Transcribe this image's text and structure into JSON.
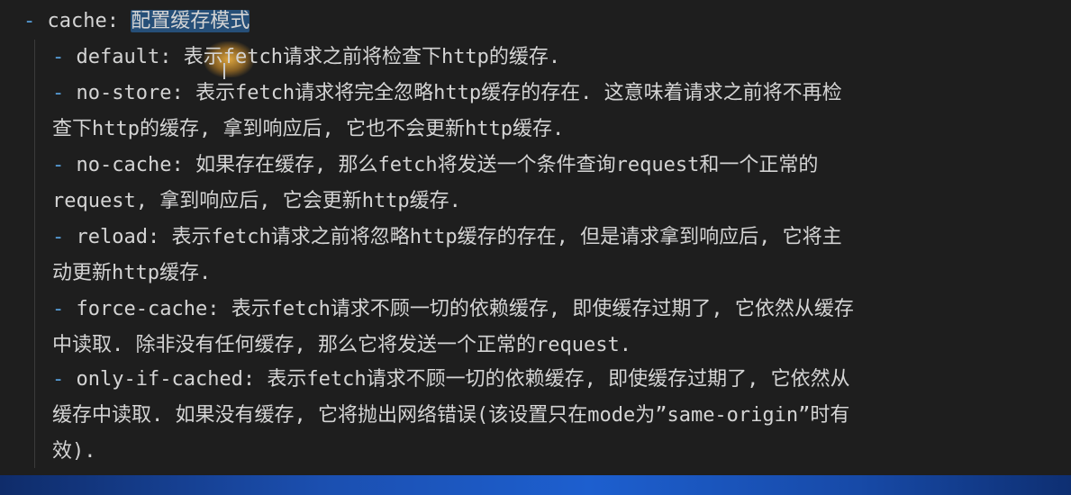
{
  "lines": [
    {
      "dash": "- ",
      "key": "cache: ",
      "text": "配置缓存模式"
    },
    {
      "dash": "- ",
      "key": "default: ",
      "text": "表示fetch请求之前将检查下http的缓存."
    },
    {
      "dash": "- ",
      "key": "no-store: ",
      "text": "表示fetch请求将完全忽略http缓存的存在. 这意味着请求之前将不再检"
    },
    {
      "dash": "",
      "key": "",
      "text": "查下http的缓存, 拿到响应后, 它也不会更新http缓存."
    },
    {
      "dash": "- ",
      "key": "no-cache: ",
      "text": "如果存在缓存, 那么fetch将发送一个条件查询request和一个正常的"
    },
    {
      "dash": "",
      "key": "",
      "text": "request, 拿到响应后, 它会更新http缓存."
    },
    {
      "dash": "- ",
      "key": "reload: ",
      "text": "表示fetch请求之前将忽略http缓存的存在, 但是请求拿到响应后, 它将主"
    },
    {
      "dash": "",
      "key": "",
      "text": "动更新http缓存."
    },
    {
      "dash": "- ",
      "key": "force-cache: ",
      "text": "表示fetch请求不顾一切的依赖缓存, 即使缓存过期了, 它依然从缓存"
    },
    {
      "dash": "",
      "key": "",
      "text": "中读取. 除非没有任何缓存, 那么它将发送一个正常的request."
    },
    {
      "dash": "- ",
      "key": "only-if-cached: ",
      "text": "表示fetch请求不顾一切的依赖缓存, 即使缓存过期了, 它依然从"
    },
    {
      "dash": "",
      "key": "",
      "text": "缓存中读取. 如果没有缓存, 它将抛出网络错误(该设置只在mode为”same-origin”时有"
    },
    {
      "dash": "",
      "key": "",
      "text": "效)."
    }
  ],
  "colors": {
    "background": "#1e1e1e",
    "text": "#d4d4d4",
    "list_marker": "#569cd6",
    "selection": "#264f78"
  },
  "icons": [
    "mouse-cursor-icon"
  ]
}
